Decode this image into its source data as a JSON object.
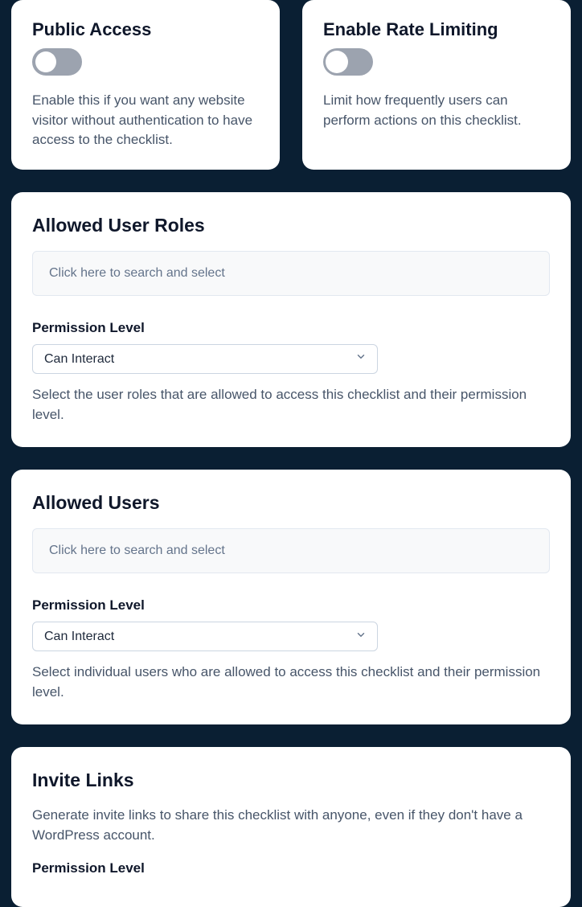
{
  "public_access": {
    "title": "Public Access",
    "desc": "Enable this if you want any website visitor without authentication to have access to the checklist."
  },
  "rate_limiting": {
    "title": "Enable Rate Limiting",
    "desc": "Limit how frequently users can perform actions on this checklist."
  },
  "allowed_roles": {
    "title": "Allowed User Roles",
    "search_placeholder": "Click here to search and select",
    "perm_label": "Permission Level",
    "perm_value": "Can Interact",
    "help": "Select the user roles that are allowed to access this checklist and their permission level."
  },
  "allowed_users": {
    "title": "Allowed Users",
    "search_placeholder": "Click here to search and select",
    "perm_label": "Permission Level",
    "perm_value": "Can Interact",
    "help": "Select individual users who are allowed to access this checklist and their permission level."
  },
  "invite_links": {
    "title": "Invite Links",
    "desc": "Generate invite links to share this checklist with anyone, even if they don't have a WordPress account.",
    "perm_label": "Permission Level"
  }
}
